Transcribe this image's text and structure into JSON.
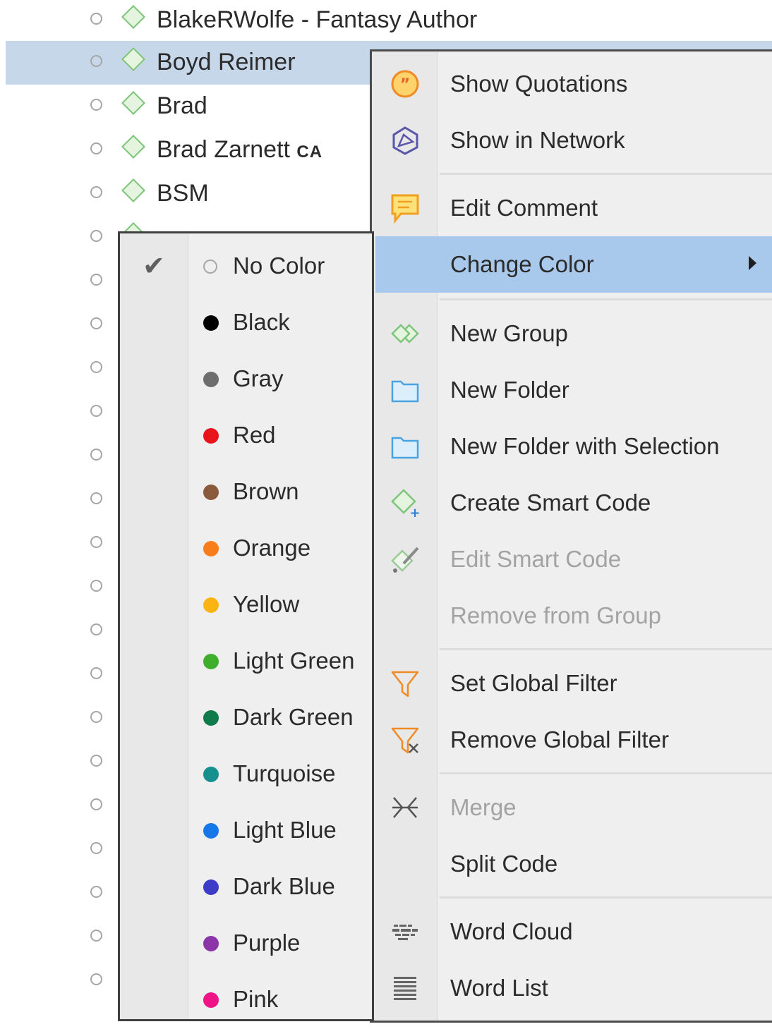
{
  "code_list": {
    "rows": [
      {
        "name": "BlakeRWolfe - Fantasy Author",
        "suffix": "",
        "selected": false
      },
      {
        "name": "Boyd Reimer",
        "suffix": "",
        "selected": true
      },
      {
        "name": "Brad",
        "suffix": "",
        "selected": false
      },
      {
        "name": "Brad Zarnett ",
        "suffix": "CA",
        "selected": false
      },
      {
        "name": "BSM",
        "suffix": "",
        "selected": false
      }
    ]
  },
  "context_menu": {
    "items": {
      "show_quotations": "Show Quotations",
      "show_in_network": "Show in Network",
      "edit_comment": "Edit Comment",
      "change_color": "Change Color",
      "new_group": "New Group",
      "new_folder": "New Folder",
      "new_folder_with_selection": "New Folder with Selection",
      "create_smart_code": "Create Smart Code",
      "edit_smart_code": "Edit Smart Code",
      "remove_from_group": "Remove from Group",
      "set_global_filter": "Set Global Filter",
      "remove_global_filter": "Remove Global Filter",
      "merge": "Merge",
      "split_code": "Split Code",
      "word_cloud": "Word Cloud",
      "word_list": "Word List"
    }
  },
  "color_submenu": {
    "selected": "No Color",
    "colors": [
      {
        "label": "No Color",
        "hex": ""
      },
      {
        "label": "Black",
        "hex": "#000000"
      },
      {
        "label": "Gray",
        "hex": "#6e6e6e"
      },
      {
        "label": "Red",
        "hex": "#e8141b"
      },
      {
        "label": "Brown",
        "hex": "#8a5a3c"
      },
      {
        "label": "Orange",
        "hex": "#f97d18"
      },
      {
        "label": "Yellow",
        "hex": "#fbb414"
      },
      {
        "label": "Light Green",
        "hex": "#3fae2a"
      },
      {
        "label": "Dark Green",
        "hex": "#0f7a4a"
      },
      {
        "label": "Turquoise",
        "hex": "#14918f"
      },
      {
        "label": "Light Blue",
        "hex": "#1478e8"
      },
      {
        "label": "Dark Blue",
        "hex": "#3c3cc8"
      },
      {
        "label": "Purple",
        "hex": "#8c35a8"
      },
      {
        "label": "Pink",
        "hex": "#ee1488"
      }
    ]
  },
  "theme": {
    "selection_highlight": "#c7d7ea",
    "menu_highlight": "#a9c9ec",
    "code_diamond": "#7ec57b"
  }
}
